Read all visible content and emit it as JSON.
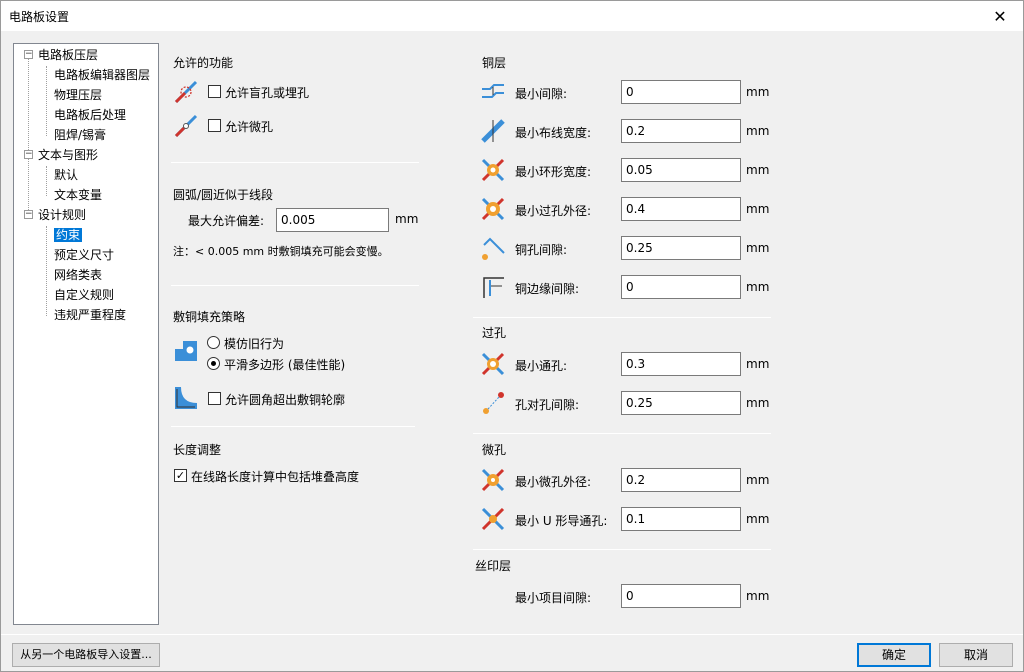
{
  "window": {
    "title": "电路板设置",
    "close_glyph": "✕"
  },
  "tree": {
    "items": [
      {
        "label": "电路板压层",
        "expander": "−"
      },
      {
        "label": "电路板编辑器图层"
      },
      {
        "label": "物理压层"
      },
      {
        "label": "电路板后处理"
      },
      {
        "label": "阻焊/锡膏"
      },
      {
        "label": "文本与图形",
        "expander": "−"
      },
      {
        "label": "默认"
      },
      {
        "label": "文本变量"
      },
      {
        "label": "设计规则",
        "expander": "−"
      },
      {
        "label": "约束"
      },
      {
        "label": "预定义尺寸"
      },
      {
        "label": "网络类表"
      },
      {
        "label": "自定义规则"
      },
      {
        "label": "违规严重程度"
      }
    ]
  },
  "features": {
    "header": "允许的功能",
    "blind_buried": "允许盲孔或埋孔",
    "micro_vias": "允许微孔"
  },
  "arc": {
    "header": "圆弧/圆近似于线段",
    "max_error_label": "最大允许偏差:",
    "max_error_value": "0.005",
    "unit": "mm",
    "note": "注：< 0.005 mm 时敷铜填充可能会变慢。"
  },
  "zone": {
    "header": "敷铜填充策略",
    "opt_legacy": "模仿旧行为",
    "opt_smooth": "平滑多边形 (最佳性能)",
    "allow_fillet": "允许圆角超出敷铜轮廓"
  },
  "length": {
    "header": "长度调整",
    "include_stackup": "在线路长度计算中包括堆叠高度",
    "checked_glyph": "✓"
  },
  "copper": {
    "header": "铜层",
    "rows": [
      {
        "label": "最小间隙:",
        "value": "0",
        "unit": "mm"
      },
      {
        "label": "最小布线宽度:",
        "value": "0.2",
        "unit": "mm"
      },
      {
        "label": "最小环形宽度:",
        "value": "0.05",
        "unit": "mm"
      },
      {
        "label": "最小过孔外径:",
        "value": "0.4",
        "unit": "mm"
      },
      {
        "label": "铜孔间隙:",
        "value": "0.25",
        "unit": "mm"
      },
      {
        "label": "铜边缘间隙:",
        "value": "0",
        "unit": "mm"
      }
    ]
  },
  "holes": {
    "header": "过孔",
    "rows": [
      {
        "label": "最小通孔:",
        "value": "0.3",
        "unit": "mm"
      },
      {
        "label": "孔对孔间隙:",
        "value": "0.25",
        "unit": "mm"
      }
    ]
  },
  "microvias": {
    "header": "微孔",
    "rows": [
      {
        "label": "最小微孔外径:",
        "value": "0.2",
        "unit": "mm"
      },
      {
        "label": "最小 U 形导通孔:",
        "value": "0.1",
        "unit": "mm"
      }
    ]
  },
  "silk": {
    "header": "丝印层",
    "rows": [
      {
        "label": "最小项目间隙:",
        "value": "0",
        "unit": "mm"
      }
    ]
  },
  "buttons": {
    "import": "从另一个电路板导入设置...",
    "ok": "确定",
    "cancel": "取消"
  },
  "colors": {
    "accent": "#0078d7",
    "icon_blue": "#3b8fd8",
    "icon_red": "#d0342c",
    "icon_orange": "#f0a030"
  }
}
